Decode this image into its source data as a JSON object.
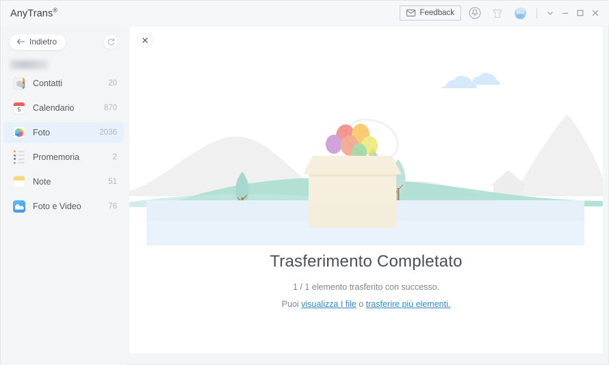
{
  "window": {
    "app_title": "AnyTrans",
    "app_title_mark": "®",
    "feedback_label": "Feedback",
    "icons": {
      "feedback": "envelope-icon",
      "notifications": "bell-icon",
      "gift": "tshirt-gift-icon",
      "account": "avatar-icon",
      "more": "chevron-down-icon",
      "minimize": "minimize-icon",
      "maximize": "maximize-icon",
      "close": "close-icon"
    }
  },
  "sidebar": {
    "back_label": "Indietro",
    "back_icon": "arrow-left-icon",
    "refresh_icon": "refresh-icon",
    "device_name": "",
    "items": [
      {
        "label": "Contatti",
        "count": "20",
        "icon": "contacts-icon",
        "active": false
      },
      {
        "label": "Calendario",
        "count": "870",
        "icon": "calendar-icon",
        "active": false
      },
      {
        "label": "Foto",
        "count": "2036",
        "icon": "photos-icon",
        "active": true
      },
      {
        "label": "Promemoria",
        "count": "2",
        "icon": "reminders-icon",
        "active": false
      },
      {
        "label": "Note",
        "count": "51",
        "icon": "notes-icon",
        "active": false
      },
      {
        "label": "Foto e Video",
        "count": "76",
        "icon": "photos-video-icon",
        "active": false
      }
    ],
    "calendar_day": "5"
  },
  "main": {
    "close_icon": "close-icon",
    "illustration": "transfer-complete-illustration",
    "headline": "Trasferimento Completato",
    "subline": "1 / 1 elemento trasferito con successo.",
    "hint_prefix": "Puoi ",
    "link_view_files": "visualizza I file",
    "hint_middle": " o ",
    "link_transfer_more": "trasferire più elementi.",
    "hint_suffix": ""
  },
  "colors": {
    "accent_link": "#2f8ad8",
    "selected_row": "#e7f1fb",
    "window_bg": "#f4f5f7",
    "panel_bg": "#ffffff",
    "hill_green": "#a8ddd0",
    "water_blue": "#e8f2fb",
    "cloud_blue": "#d4eafb",
    "box_cream": "#f6eedd"
  }
}
